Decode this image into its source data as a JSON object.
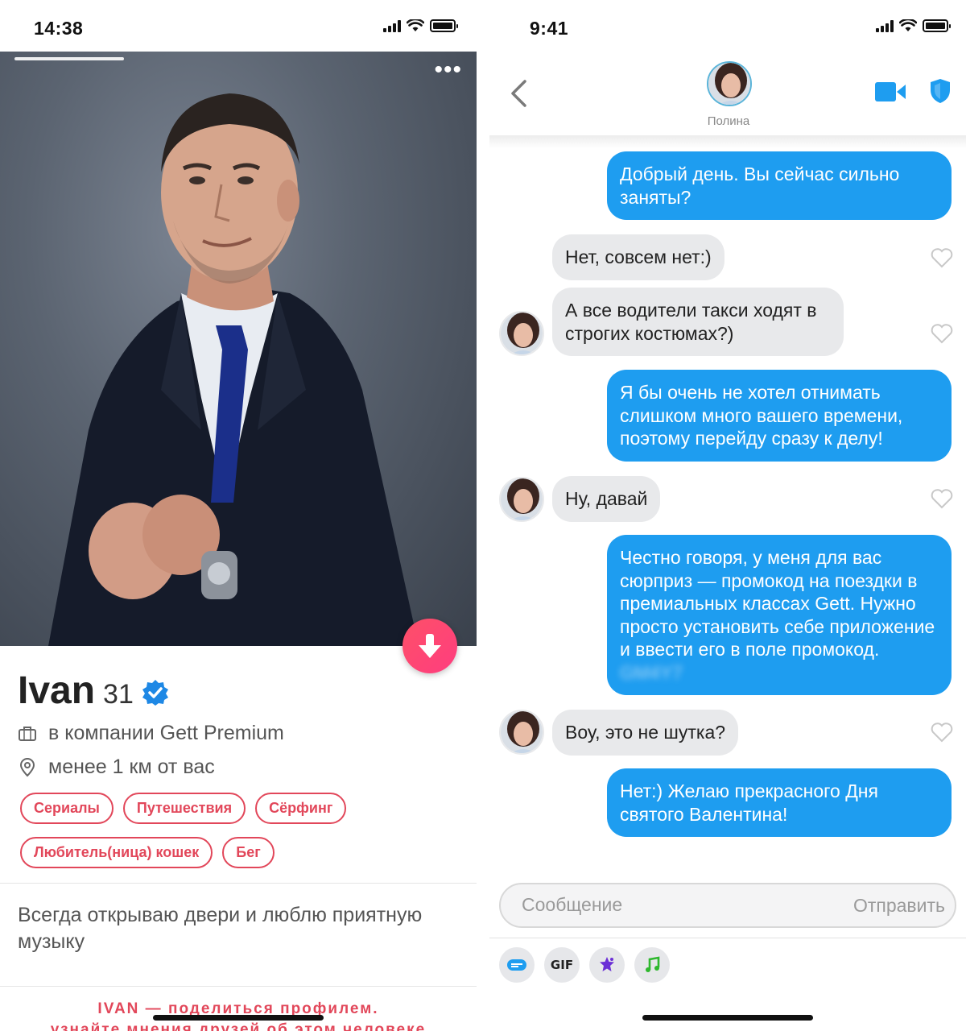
{
  "left": {
    "status": {
      "time": "14:38"
    },
    "profile": {
      "name": "Ivan",
      "age": "31",
      "work": "в компании Gett Premium",
      "distance": "менее 1 км от вас",
      "tags": [
        "Сериалы",
        "Путешествия",
        "Сёрфинг",
        "Любитель(ница) кошек",
        "Бег"
      ],
      "bio": "Всегда открываю двери и люблю приятную музыку",
      "share_line1": "IVAN — поделиться профилем.",
      "share_line2": "узнайте мнения друзей об этом человеке"
    },
    "colors": {
      "accent": "#e2475a",
      "verified": "#1e88e5"
    }
  },
  "right": {
    "status": {
      "time": "9:41"
    },
    "header": {
      "contact_name": "Полина"
    },
    "messages": [
      {
        "from": "me",
        "text": "Добрый день. Вы сейчас сильно заняты?"
      },
      {
        "from": "them",
        "text": "Нет, совсем нет:)"
      },
      {
        "from": "them",
        "text": "А все водители такси ходят в строгих костюмах?)"
      },
      {
        "from": "me",
        "text": "Я бы очень не хотел отнимать слишком много вашего времени, поэтому перейду сразу к делу!"
      },
      {
        "from": "them",
        "text": "Ну, давай"
      },
      {
        "from": "me",
        "text": "Честно говоря, у меня для вас сюрприз — промокод на поездки в премиальных классах Gett. Нужно просто установить себе приложение и ввести его в поле промокод.",
        "promo_blurred": "GM4Y7"
      },
      {
        "from": "them",
        "text": "Воу, это не шутка?"
      },
      {
        "from": "me",
        "text": "Нет:) Желаю прекрасного Дня святого Валентина!"
      }
    ],
    "composer": {
      "placeholder": "Сообщение",
      "send_label": "Отправить"
    },
    "tools": [
      "chip-icon",
      "gif",
      "sticker-icon",
      "music-icon"
    ],
    "gif_label": "GIF",
    "colors": {
      "outgoing": "#1e9df0",
      "incoming": "#e8e9eb",
      "icon_blue": "#1e9df0"
    }
  }
}
